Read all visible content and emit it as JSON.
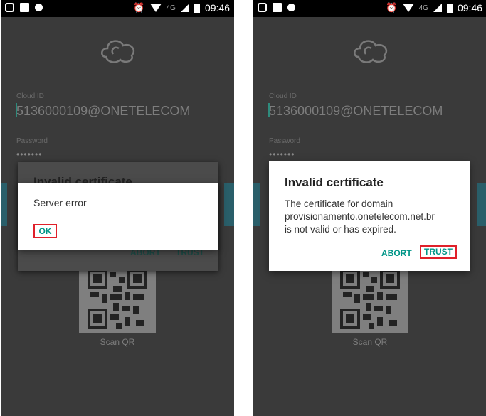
{
  "status_bar": {
    "network": "4G",
    "time": "09:46",
    "left_icons": [
      "screenshot-icon",
      "image-icon",
      "notification-dot-icon"
    ],
    "right_icons": [
      "alarm-icon",
      "wifi-icon",
      "signal-icon",
      "battery-icon"
    ]
  },
  "login": {
    "cloud_id_label": "Cloud ID",
    "cloud_id_value": "5136000109@ONETELECOM",
    "password_label": "Password",
    "password_value": "•••••••",
    "scan_qr_label": "Scan QR"
  },
  "left_screen": {
    "back_dialog": {
      "title": "Invalid certificate",
      "abort_label": "ABORT",
      "trust_label": "TRUST"
    },
    "error_dialog": {
      "message": "Server error",
      "ok_label": "OK"
    }
  },
  "right_screen": {
    "dialog": {
      "title": "Invalid certificate",
      "body_line1": "The certificate for domain",
      "body_line2": "provisionamento.onetelecom.net.br",
      "body_line3": "is not valid or has expired.",
      "abort_label": "ABORT",
      "trust_label": "TRUST"
    }
  },
  "colors": {
    "accent": "#009688",
    "highlight": "#e0202a",
    "background": "#3a3a3a"
  }
}
